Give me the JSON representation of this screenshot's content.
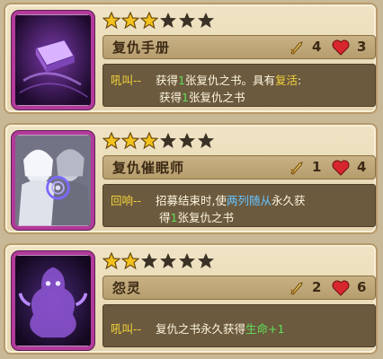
{
  "cards": [
    {
      "name": "复仇手册",
      "stars_filled": 3,
      "stars_total": 6,
      "cost": "4",
      "hp": "3",
      "portrait_icon": "spellbook-portrait",
      "line1": {
        "kw": "吼叫--",
        "t1": "获得",
        "num": "1",
        "t2": "张复仇之书。具有",
        "kw2": "复活",
        "t3": ":"
      },
      "line2": {
        "t1": "获得",
        "num": "1",
        "t2": "张复仇之书"
      }
    },
    {
      "name": "复仇催眠师",
      "stars_filled": 3,
      "stars_total": 6,
      "cost": "1",
      "hp": "4",
      "portrait_icon": "hypnotist-portrait",
      "line1": {
        "kw": "回响--",
        "t1": "招募结束时,使",
        "kw2": "两列随从",
        "t2": "永久获"
      },
      "line2": {
        "t1": "得",
        "num": "1",
        "t2": "张复仇之书"
      }
    },
    {
      "name": "怨灵",
      "stars_filled": 2,
      "stars_total": 6,
      "cost": "2",
      "hp": "6",
      "portrait_icon": "wraith-portrait",
      "line1": {
        "kw": "吼叫--",
        "t1": "复仇之书永久获得",
        "kw2": "生命+1"
      }
    }
  ],
  "colors": {
    "star": "#f3c21c",
    "star_empty": "#3b3226",
    "heart": "#d8262e",
    "keyword": "#f4d23a"
  }
}
